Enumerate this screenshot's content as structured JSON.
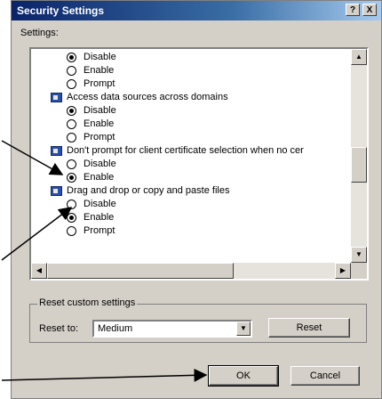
{
  "window": {
    "title": "Security Settings",
    "help_label": "?",
    "close_label": "X"
  },
  "settings_label": "Settings:",
  "list": [
    {
      "kind": "option",
      "label": "Disable",
      "checked": true
    },
    {
      "kind": "option",
      "label": "Enable",
      "checked": false
    },
    {
      "kind": "option",
      "label": "Prompt",
      "checked": false
    },
    {
      "kind": "header",
      "label": "Access data sources across domains"
    },
    {
      "kind": "option",
      "label": "Disable",
      "checked": true
    },
    {
      "kind": "option",
      "label": "Enable",
      "checked": false
    },
    {
      "kind": "option",
      "label": "Prompt",
      "checked": false
    },
    {
      "kind": "header",
      "label": "Don't prompt for client certificate selection when no cer"
    },
    {
      "kind": "option",
      "label": "Disable",
      "checked": false
    },
    {
      "kind": "option",
      "label": "Enable",
      "checked": true
    },
    {
      "kind": "header",
      "label": "Drag and drop or copy and paste files"
    },
    {
      "kind": "option",
      "label": "Disable",
      "checked": false
    },
    {
      "kind": "option",
      "label": "Enable",
      "checked": true
    },
    {
      "kind": "option",
      "label": "Prompt",
      "checked": false
    }
  ],
  "reset_group": {
    "title": "Reset custom settings",
    "reset_to_label": "Reset to:",
    "selected_level": "Medium",
    "reset_button": "Reset"
  },
  "buttons": {
    "ok": "OK",
    "cancel": "Cancel"
  },
  "colors": {
    "titlebar_start": "#0a246a",
    "dialog_bg": "#d4d0c8"
  }
}
